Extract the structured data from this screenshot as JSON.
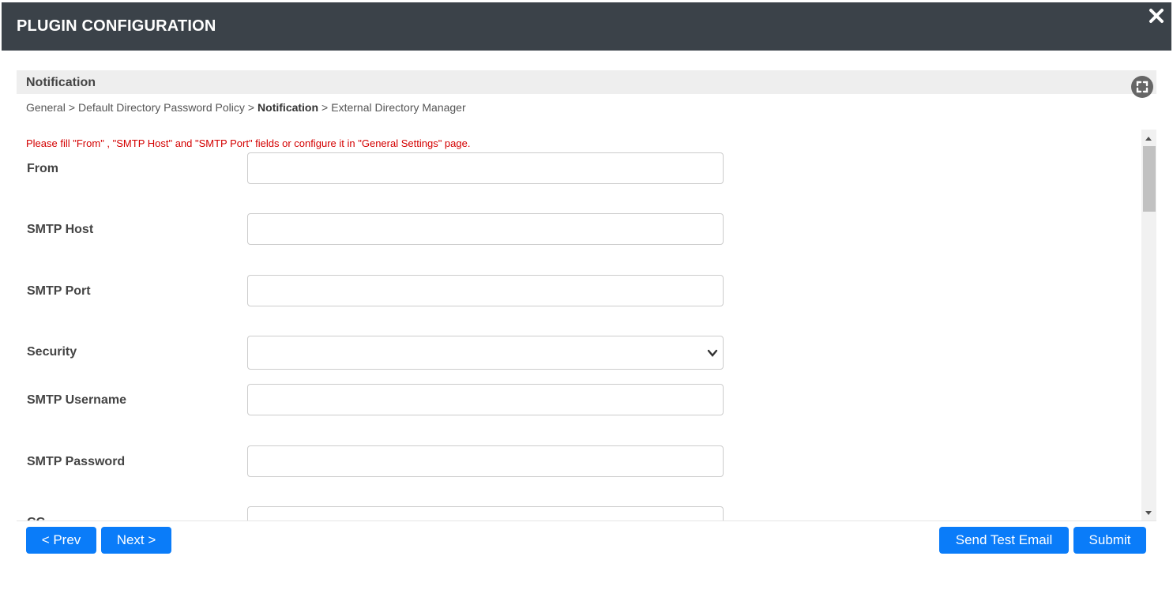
{
  "dialog": {
    "title": "PLUGIN CONFIGURATION",
    "close_icon": "close-icon"
  },
  "section": {
    "title": "Notification",
    "expand_icon": "fullscreen-icon"
  },
  "breadcrumb": {
    "items": [
      "General",
      "Default Directory Password Policy",
      "Notification",
      "External Directory Manager"
    ],
    "separator": ">",
    "current_index": 2
  },
  "form": {
    "warning": "Please fill \"From\" , \"SMTP Host\" and \"SMTP Port\" fields or configure it in \"General Settings\" page.",
    "fields": [
      {
        "label": "From",
        "value": ""
      },
      {
        "label": "SMTP Host",
        "value": ""
      },
      {
        "label": "SMTP Port",
        "value": ""
      },
      {
        "label": "Security",
        "value": ""
      },
      {
        "label": "SMTP Username",
        "value": ""
      },
      {
        "label": "SMTP Password",
        "value": ""
      },
      {
        "label": "CC",
        "value": ""
      }
    ]
  },
  "footer": {
    "prev_label": "< Prev",
    "next_label": "Next >",
    "test_email_label": "Send Test Email",
    "submit_label": "Submit"
  },
  "colors": {
    "titlebar": "#3b4249",
    "primary_button": "#0a7cf9",
    "warning_text": "#d40000",
    "section_header_bg": "#eeeeee"
  }
}
